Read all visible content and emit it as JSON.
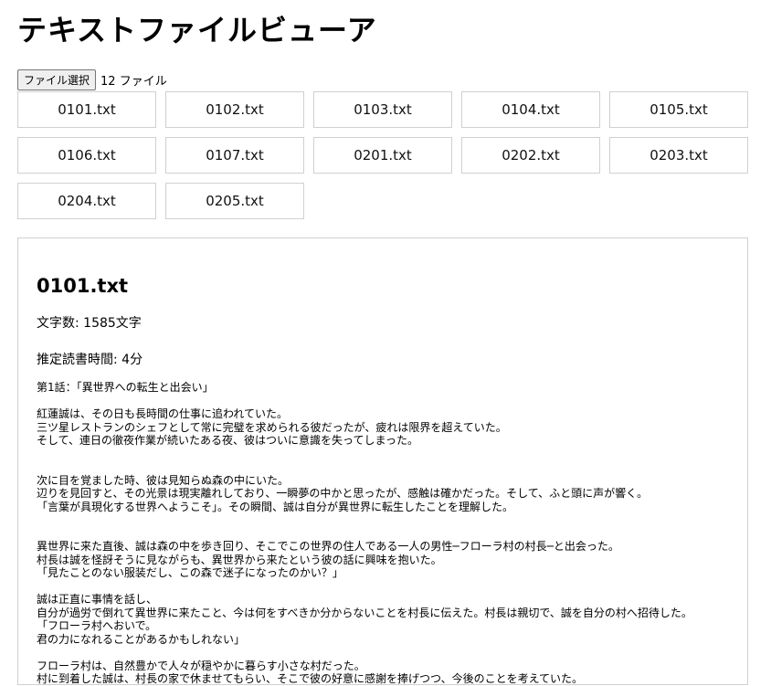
{
  "app": {
    "title": "テキストファイルビューア"
  },
  "picker": {
    "button_label": "ファイル選択",
    "count_label": "12 ファイル"
  },
  "files": [
    "0101.txt",
    "0102.txt",
    "0103.txt",
    "0104.txt",
    "0105.txt",
    "0106.txt",
    "0107.txt",
    "0201.txt",
    "0202.txt",
    "0203.txt",
    "0204.txt",
    "0205.txt"
  ],
  "viewer": {
    "filename": "0101.txt",
    "char_count": "文字数: 1585文字",
    "reading_time": "推定読書時間: 4分",
    "content": "第1話：「異世界への転生と出会い」\n\n紅蓮誠は、その日も長時間の仕事に追われていた。\n三ツ星レストランのシェフとして常に完璧を求められる彼だったが、疲れは限界を超えていた。\nそして、連日の徹夜作業が続いたある夜、彼はついに意識を失ってしまった。\n\n\n次に目を覚ました時、彼は見知らぬ森の中にいた。\n辺りを見回すと、その光景は現実離れしており、一瞬夢の中かと思ったが、感触は確かだった。そして、ふと頭に声が響く。\n「言葉が具現化する世界へようこそ」。その瞬間、誠は自分が異世界に転生したことを理解した。\n\n\n異世界に来た直後、誠は森の中を歩き回り、そこでこの世界の住人である一人の男性─フローラ村の村長─と出会った。\n村長は誠を怪訝そうに見ながらも、異世界から来たという彼の話に興味を抱いた。\n「見たことのない服装だし、この森で迷子になったのかい？」\n\n誠は正直に事情を話し、\n自分が過労で倒れて異世界に来たこと、今は何をすべきか分からないことを村長に伝えた。村長は親切で、誠を自分の村へ招待した。\n「フローラ村へおいで。\n君の力になれることがあるかもしれない」\n\nフローラ村は、自然豊かで人々が穏やかに暮らす小さな村だった。\n村に到着した誠は、村長の家で休ませてもらい、そこで彼の好意に感謝を捧げつつ、今後のことを考えていた。"
  }
}
